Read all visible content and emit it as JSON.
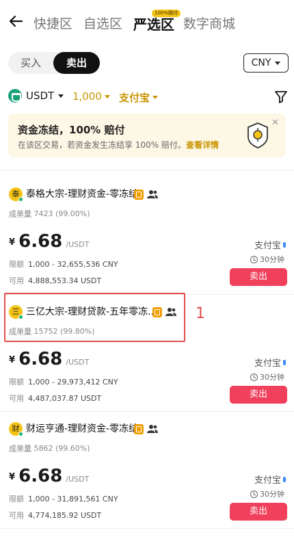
{
  "nav": {
    "tabs": [
      "快捷区",
      "自选区",
      "严选区",
      "数字商城"
    ],
    "active_tab": "严选区",
    "tab_badge": "100%赔付"
  },
  "toggle": {
    "buy": "买入",
    "sell": "卖出"
  },
  "currency": "CNY",
  "filters": {
    "coin": "USDT",
    "amount": "1,000",
    "payment": "支付宝"
  },
  "banner": {
    "title": "资金冻结，100% 赔付",
    "text": "在该区交易，若资金发生冻结享 100% 赔付。",
    "link": "查看详情"
  },
  "merchants": [
    {
      "avatar": "泰",
      "name": "泰格大宗-理财资金-零冻结",
      "orders_label": "成单量",
      "orders": "7423 (99.00%)",
      "currency_symbol": "¥",
      "price": "6.68",
      "unit": "/USDT",
      "limit_label": "限额",
      "limit": "1,000 - 32,655,536 CNY",
      "available_label": "可用",
      "available": "4,888,553.34 USDT",
      "payment": "支付宝",
      "time": "30分钟",
      "action": "卖出"
    },
    {
      "avatar": "三",
      "name": "三亿大宗-理财贷款-五年零冻...",
      "orders_label": "成单量",
      "orders": "15752 (99.80%)",
      "currency_symbol": "¥",
      "price": "6.68",
      "unit": "/USDT",
      "limit_label": "限额",
      "limit": "1,000 - 29,973,412 CNY",
      "available_label": "可用",
      "available": "4,487,037.87 USDT",
      "payment": "支付宝",
      "time": "30分钟",
      "action": "卖出"
    },
    {
      "avatar": "财",
      "name": "财运亨通-理财资金-零冻结",
      "orders_label": "成单量",
      "orders": "5862 (99.60%)",
      "currency_symbol": "¥",
      "price": "6.68",
      "unit": "/USDT",
      "limit_label": "限额",
      "limit": "1,000 - 31,891,561 CNY",
      "available_label": "可用",
      "available": "4,774,185.92 USDT",
      "payment": "支付宝",
      "time": "30分钟",
      "action": "卖出"
    }
  ],
  "annotation": "1",
  "colors": {
    "accent": "#f6c416",
    "gold_text": "#c99400",
    "sell_red": "#f0405b",
    "annotation_red": "#e34c4c"
  }
}
